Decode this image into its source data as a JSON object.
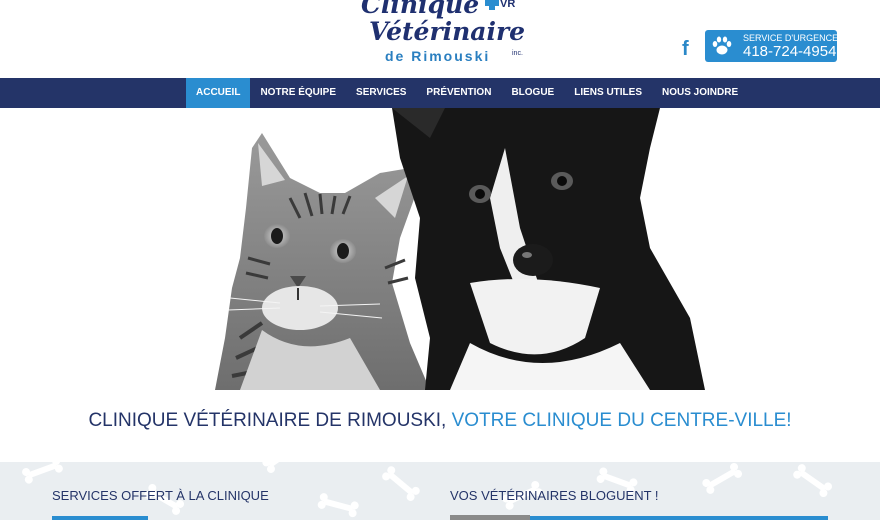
{
  "logo": {
    "line1": "Clinique",
    "line2": "Vétérinaire",
    "line3": "de Rimouski",
    "inc": "inc.",
    "badge": "VR"
  },
  "header": {
    "facebook_glyph": "f",
    "emergency_label": "SERVICE D'URGENCE",
    "emergency_phone": "418-724-4954"
  },
  "nav": {
    "items": [
      {
        "label": "ACCUEIL",
        "active": true
      },
      {
        "label": "NOTRE ÉQUIPE",
        "active": false
      },
      {
        "label": "SERVICES",
        "active": false
      },
      {
        "label": "PRÉVENTION",
        "active": false
      },
      {
        "label": "BLOGUE",
        "active": false
      },
      {
        "label": "LIENS UTILES",
        "active": false
      },
      {
        "label": "NOUS JOINDRE",
        "active": false
      }
    ]
  },
  "tagline": {
    "part1": "CLINIQUE VÉTÉRINAIRE DE RIMOUSKI, ",
    "part2": "VOTRE CLINIQUE DU CENTRE-VILLE!"
  },
  "sections": {
    "left_title": "SERVICES OFFERT À LA CLINIQUE",
    "right_title": "VOS VÉTÉRINAIRES BLOGUENT !"
  },
  "colors": {
    "navy": "#243468",
    "accent": "#2a8dd0",
    "band": "#eaeef1"
  },
  "icons": {
    "facebook": "facebook-icon",
    "paw": "paw-icon",
    "bone": "bone-icon"
  }
}
